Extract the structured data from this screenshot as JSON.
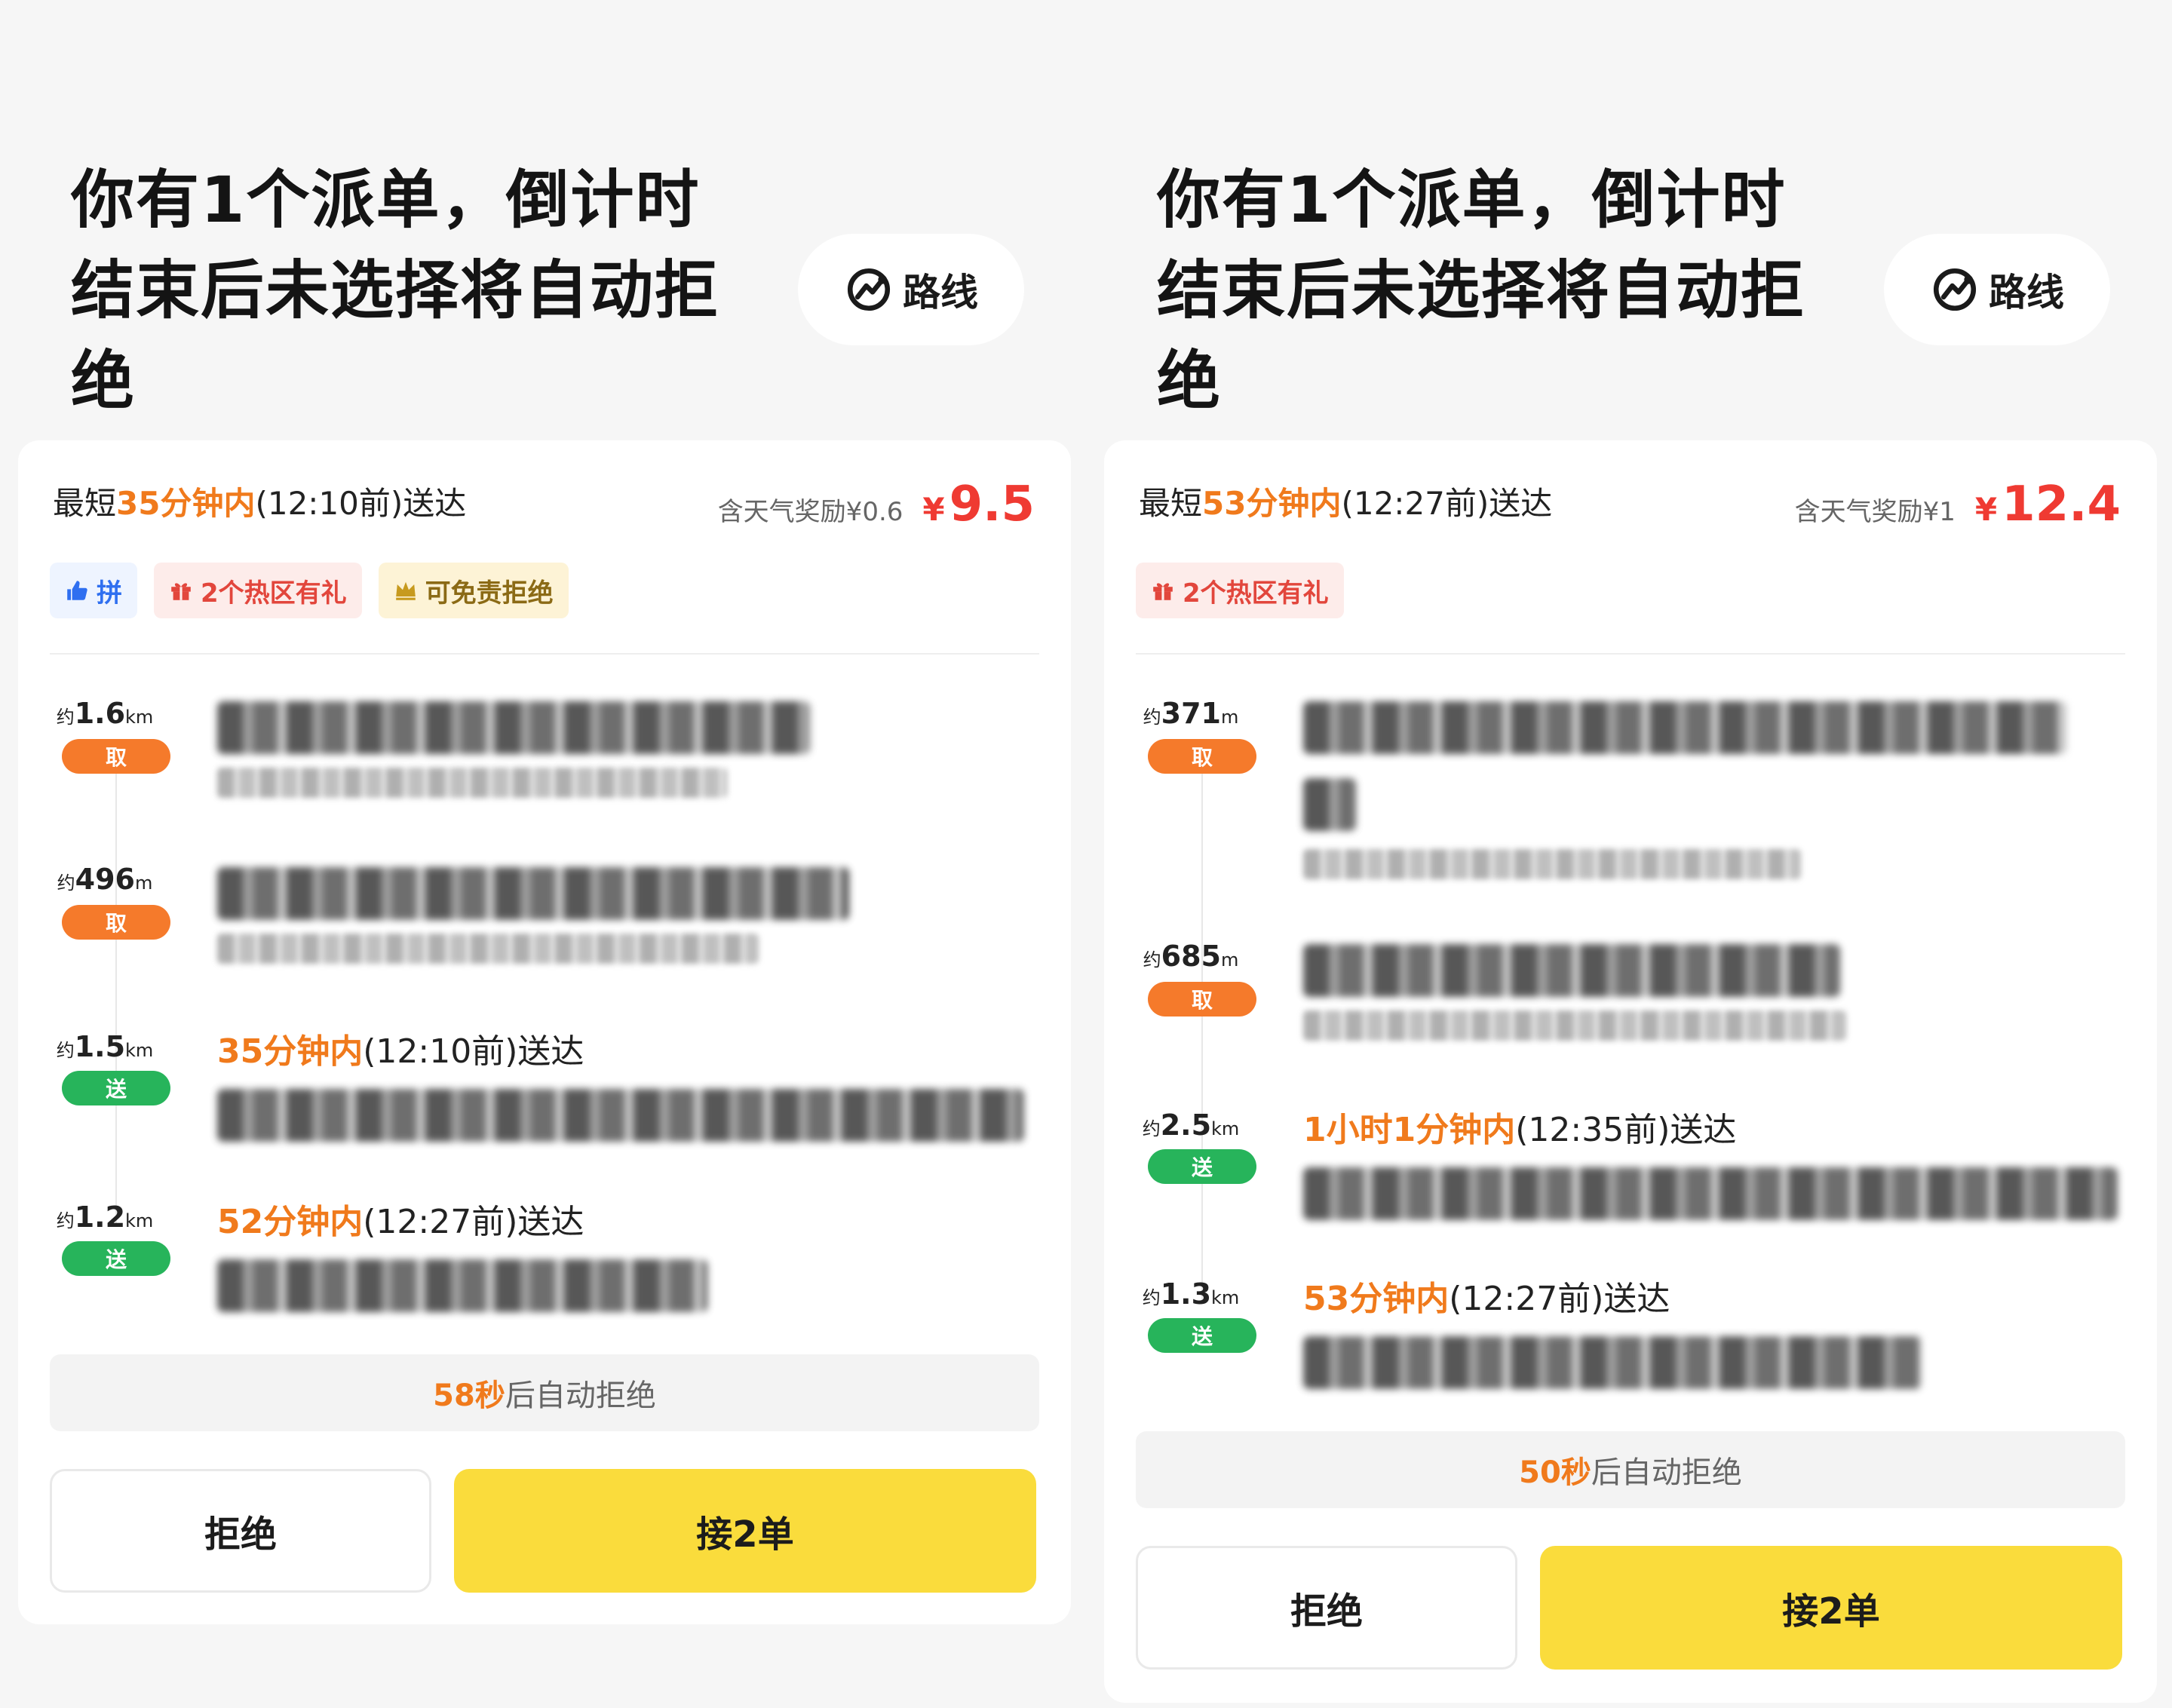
{
  "left": {
    "headline_l1": "你有1个派单，倒计时",
    "headline_l2": "结束后未选择将自动拒",
    "headline_l3": "绝",
    "route_label": "路线",
    "eta_prefix": "最短",
    "eta_highlight": "35分钟内",
    "eta_suffix": "(12:10前)送达",
    "bonus": "含天气奖励¥0.6",
    "price_symbol": "¥",
    "price": "9.5",
    "tags": [
      "拼",
      "2个热区有礼",
      "可免责拒绝"
    ],
    "stops": [
      {
        "prefix": "约",
        "dist": "1.6",
        "unit": "km",
        "badge": "取"
      },
      {
        "prefix": "约",
        "dist": "496",
        "unit": "m",
        "badge": "取"
      },
      {
        "prefix": "约",
        "dist": "1.5",
        "unit": "km",
        "badge": "送",
        "deliver_hl": "35分钟内",
        "deliver_rest": "(12:10前)送达"
      },
      {
        "prefix": "约",
        "dist": "1.2",
        "unit": "km",
        "badge": "送",
        "deliver_hl": "52分钟内",
        "deliver_rest": "(12:27前)送达"
      }
    ],
    "countdown_hl": "58秒",
    "countdown_rest": "后自动拒绝",
    "reject_label": "拒绝",
    "accept_label": "接2单"
  },
  "right": {
    "headline_l1": "你有1个派单，倒计时",
    "headline_l2": "结束后未选择将自动拒",
    "headline_l3": "绝",
    "route_label": "路线",
    "eta_prefix": "最短",
    "eta_highlight": "53分钟内",
    "eta_suffix": "(12:27前)送达",
    "bonus": "含天气奖励¥1",
    "price_symbol": "¥",
    "price": "12.4",
    "tags": [
      "2个热区有礼"
    ],
    "stops": [
      {
        "prefix": "约",
        "dist": "371",
        "unit": "m",
        "badge": "取"
      },
      {
        "prefix": "约",
        "dist": "685",
        "unit": "m",
        "badge": "取"
      },
      {
        "prefix": "约",
        "dist": "2.5",
        "unit": "km",
        "badge": "送",
        "deliver_hl": "1小时1分钟内",
        "deliver_rest": "(12:35前)送达"
      },
      {
        "prefix": "约",
        "dist": "1.3",
        "unit": "km",
        "badge": "送",
        "deliver_hl": "53分钟内",
        "deliver_rest": "(12:27前)送达"
      }
    ],
    "countdown_hl": "50秒",
    "countdown_rest": "后自动拒绝",
    "reject_label": "拒绝",
    "accept_label": "接2单"
  },
  "colors": {
    "accent_orange": "#f07a1c",
    "price_red": "#ef3a32",
    "pickup_badge": "#f57a2b",
    "dropoff_badge": "#27b45b",
    "accept_yellow": "#fadc3c"
  }
}
